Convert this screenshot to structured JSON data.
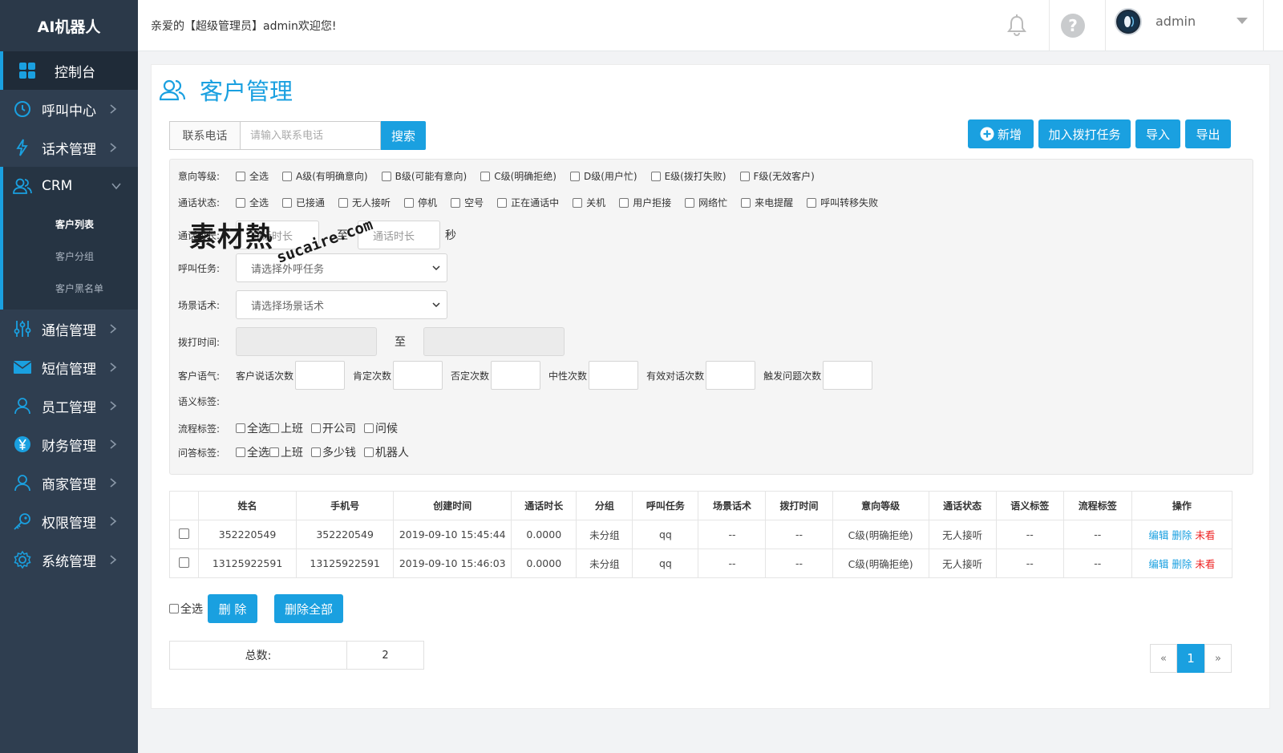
{
  "brand": "AI机器人",
  "sidebar": {
    "items": [
      {
        "label": "控制台",
        "icon": "dashboard-icon"
      },
      {
        "label": "呼叫中心",
        "icon": "clock-icon"
      },
      {
        "label": "话术管理",
        "icon": "lightning-icon"
      },
      {
        "label": "CRM",
        "icon": "users-icon"
      },
      {
        "label": "通信管理",
        "icon": "sliders-icon"
      },
      {
        "label": "短信管理",
        "icon": "envelope-icon"
      },
      {
        "label": "员工管理",
        "icon": "user-icon"
      },
      {
        "label": "财务管理",
        "icon": "yen-icon"
      },
      {
        "label": "商家管理",
        "icon": "user-icon"
      },
      {
        "label": "权限管理",
        "icon": "key-icon"
      },
      {
        "label": "系统管理",
        "icon": "gear-icon"
      }
    ],
    "crm_sub": [
      "客户列表",
      "客户分组",
      "客户黑名单"
    ]
  },
  "topbar": {
    "welcome": "亲爱的【超级管理员】admin欢迎您!",
    "username": "admin"
  },
  "page": {
    "title": "客户管理",
    "search_label": "联系电话",
    "search_placeholder": "请输入联系电话",
    "search_btn": "搜索",
    "actions": {
      "add": "新增",
      "add_task": "加入拨打任务",
      "import": "导入",
      "export": "导出"
    }
  },
  "filters": {
    "intent_label": "意向等级:",
    "intent_options": [
      "全选",
      "A级(有明确意向)",
      "B级(可能有意向)",
      "C级(明确拒绝)",
      "D级(用户忙)",
      "E级(拨打失败)",
      "F级(无效客户)"
    ],
    "status_label": "通话状态:",
    "status_options": [
      "全选",
      "已接通",
      "无人接听",
      "停机",
      "空号",
      "正在通话中",
      "关机",
      "用户拒接",
      "网络忙",
      "来电提醒",
      "呼叫转移失败"
    ],
    "duration_label": "通话时长:",
    "duration_placeholder": "通话时长",
    "duration_placeholder2": "通话时长",
    "to": "至",
    "seconds": "秒",
    "task_label": "呼叫任务:",
    "task_placeholder": "请选择外呼任务",
    "script_label": "场景话术:",
    "script_placeholder": "请选择场景话术",
    "dial_label": "拨打时间:",
    "dial_to": "至",
    "tone_label": "客户语气:",
    "tone_fields": [
      "客户说话次数",
      "肯定次数",
      "否定次数",
      "中性次数",
      "有效对话次数",
      "触发问题次数"
    ],
    "semantic_label": "语义标签:",
    "flow_label": "流程标签:",
    "flow_options": [
      "全选",
      "上班",
      "开公司",
      "问候"
    ],
    "qa_label": "问答标签:",
    "qa_options": [
      "全选",
      "上班",
      "多少钱",
      "机器人"
    ]
  },
  "table": {
    "headers": [
      "姓名",
      "手机号",
      "创建时间",
      "通话时长",
      "分组",
      "呼叫任务",
      "场景话术",
      "拨打时间",
      "意向等级",
      "通话状态",
      "语义标签",
      "流程标签",
      "操作"
    ],
    "rows": [
      [
        "352220549",
        "352220549",
        "2019-09-10 15:45:44",
        "0.0000",
        "未分组",
        "qq",
        "--",
        "--",
        "C级(明确拒绝)",
        "无人接听",
        "--",
        "--"
      ],
      [
        "13125922591",
        "13125922591",
        "2019-09-10 15:46:03",
        "0.0000",
        "未分组",
        "qq",
        "--",
        "--",
        "C级(明确拒绝)",
        "无人接听",
        "--",
        "--"
      ]
    ],
    "ops": {
      "edit": "编辑",
      "delete": "删除",
      "unseen": "未看"
    }
  },
  "bottom": {
    "select_all": "全选",
    "delete": "删 除",
    "delete_all": "删除全部",
    "total_label": "总数:",
    "total_value": "2",
    "pager_prev": "«",
    "pager_current": "1",
    "pager_next": "»"
  },
  "watermark": {
    "cn": "素材熱",
    "en": "sucaire.com"
  },
  "colors": {
    "accent": "#1aa0e0",
    "sidebar": "#2f3e50",
    "danger": "#e22222"
  }
}
